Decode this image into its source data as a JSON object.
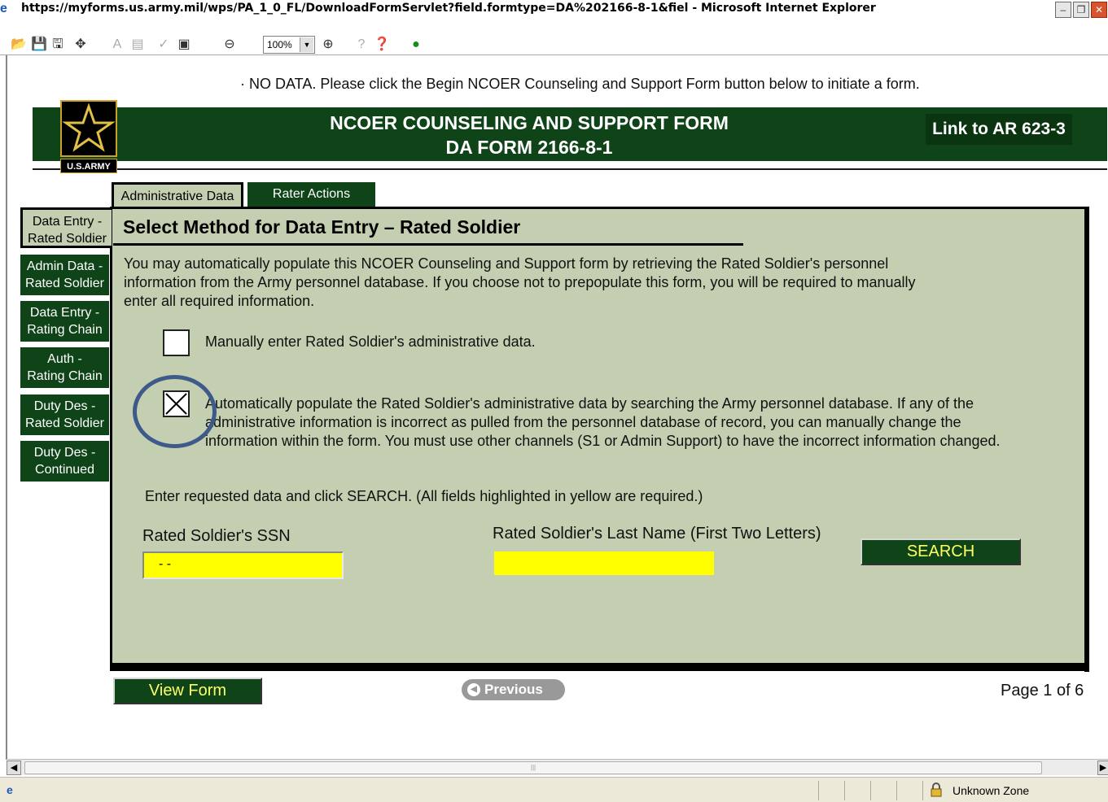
{
  "browser": {
    "title": "https://myforms.us.army.mil/wps/PA_1_0_FL/DownloadFormServlet?field.formtype=DA%202166-8-1&fiel - Microsoft Internet Explorer",
    "zoom": "100%",
    "status_zone": "Unknown Zone"
  },
  "notice": "· NO DATA. Please click the Begin NCOER Counseling and Support Form button below to initiate a form.",
  "banner": {
    "logo_text": "U.S.ARMY",
    "title_line1": "NCOER COUNSELING AND SUPPORT FORM",
    "title_line2": "DA FORM 2166-8-1",
    "link": "Link to AR 623-3"
  },
  "tabs": [
    {
      "label": "Administrative Data",
      "active": true
    },
    {
      "label": "Rater Actions",
      "active": false
    }
  ],
  "sidebar": {
    "items": [
      {
        "line1": "Data Entry -",
        "line2": "Rated Soldier",
        "active": true
      },
      {
        "line1": "Admin Data -",
        "line2": "Rated Soldier",
        "active": false
      },
      {
        "line1": "Data Entry -",
        "line2": "Rating Chain",
        "active": false
      },
      {
        "line1": "Auth -",
        "line2": "Rating Chain",
        "active": false
      },
      {
        "line1": "Duty Des -",
        "line2": "Rated Soldier",
        "active": false
      },
      {
        "line1": "Duty Des -",
        "line2": "Continued",
        "active": false
      }
    ]
  },
  "main": {
    "heading": "Select Method for Data Entry – Rated Soldier",
    "intro": "You may automatically populate this NCOER Counseling and Support form by retrieving the Rated Soldier's personnel information from the Army personnel database.  If you choose not to prepopulate this form, you will be required to manually enter all required information.",
    "option_manual": {
      "label": "Manually enter Rated Soldier's administrative data.",
      "checked": false
    },
    "option_auto": {
      "label": "Automatically populate the Rated Soldier's administrative data by searching the Army personnel database.  If any of the administrative information is incorrect as pulled from the personnel database of record, you can manually change the information within the form. You must use other channels (S1 or Admin Support) to have the incorrect information changed.",
      "checked": true
    },
    "instructions": "Enter requested data and click SEARCH. (All fields highlighted in yellow are required.)",
    "ssn_label": "Rated Soldier's SSN",
    "ssn_value": "- -",
    "lastname_label": "Rated Soldier's Last Name (First Two Letters)",
    "lastname_value": "",
    "search_label": "SEARCH"
  },
  "footer": {
    "view_form_label": "View Form",
    "previous_label": "Previous",
    "page_indicator": "Page 1 of 6"
  },
  "colors": {
    "army_green": "#0f4418",
    "panel_bg": "#c4cfb1",
    "required_yellow": "#ffff00",
    "annotation_ring": "#3e5a8a"
  }
}
